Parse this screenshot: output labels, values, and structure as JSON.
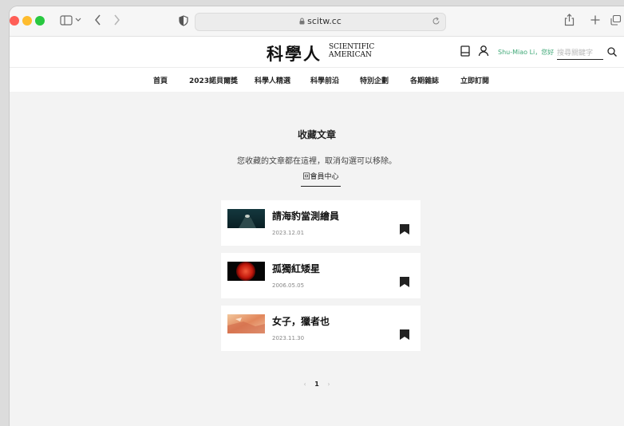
{
  "browser": {
    "url": "scitw.cc",
    "colors": {
      "close": "#ff5f57",
      "minimize": "#febc2e",
      "zoom": "#28c840"
    }
  },
  "site": {
    "logo_cn": "科學人",
    "logo_en_line1": "SCIENTIFIC",
    "logo_en_line2": "AMERICAN",
    "user_link": "Shu-Miao Li，您好",
    "search_placeholder": "搜尋關鍵字"
  },
  "nav": {
    "items": [
      "首頁",
      "2023諾貝爾獎",
      "科學人精選",
      "科學前沿",
      "特別企劃",
      "各期雜誌",
      "立即訂閱"
    ]
  },
  "page": {
    "title": "收藏文章",
    "subtitle": "您收藏的文章都在這裡，取消勾選可以移除。",
    "back_link": "回會員中心"
  },
  "articles": [
    {
      "title": "請海豹當測繪員",
      "date": "2023.12.01"
    },
    {
      "title": "孤獨紅矮星",
      "date": "2006.05.05"
    },
    {
      "title": "女子，獵者也",
      "date": "2023.11.30"
    }
  ],
  "pagination": {
    "prev": "‹",
    "current": "1",
    "next": "›"
  }
}
